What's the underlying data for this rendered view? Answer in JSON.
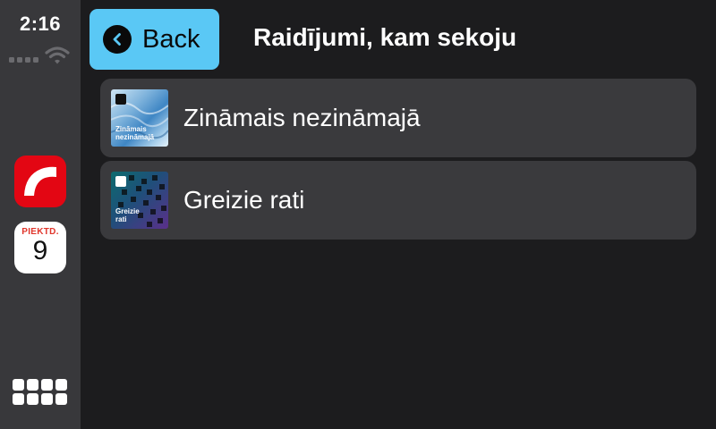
{
  "status_bar": {
    "time": "2:16"
  },
  "dock": {
    "apps": [
      {
        "name": "radio-app",
        "icon": "radio-logo-icon",
        "color": "#e30613"
      },
      {
        "name": "calendar-app",
        "icon": "calendar-icon",
        "day_label": "PIEKTD.",
        "date": "9"
      }
    ],
    "app_grid_icon": "app-grid-icon"
  },
  "header": {
    "back_label": "Back",
    "back_color": "#5ac8f5",
    "title": "Raidījumi, kam sekoju"
  },
  "items": [
    {
      "label": "Zināmais nezināmajā",
      "art_text_line1": "Zināmais",
      "art_text_line2": "nezināmajā"
    },
    {
      "label": "Greizie rati",
      "art_text_line1": "Greizie",
      "art_text_line2": "rati"
    }
  ]
}
